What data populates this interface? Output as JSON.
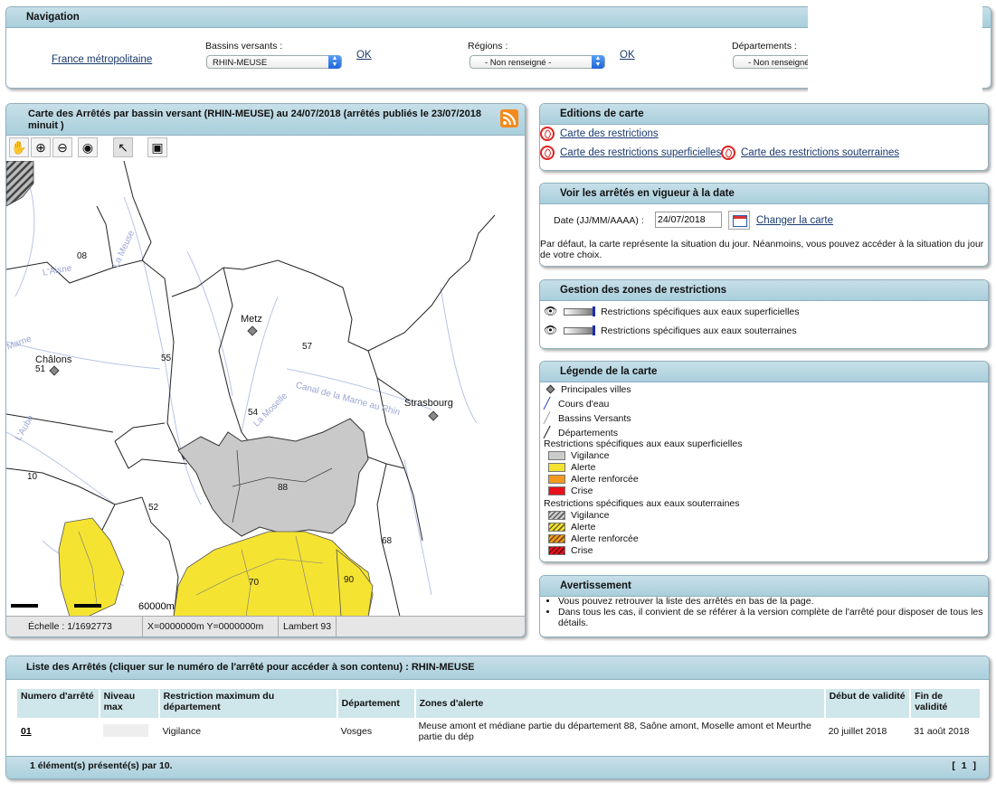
{
  "navigation": {
    "title": "Navigation",
    "france_link": "France métropolitaine",
    "bassins_label": "Bassins versants :",
    "bassins_value": "RHIN-MEUSE",
    "regions_label": "Régions :",
    "regions_value": "- Non renseigné -",
    "departements_label": "Départements :",
    "departements_value": "- Non renseigné -",
    "ok_label": "OK"
  },
  "map_panel": {
    "title": "Carte des Arrêtés par bassin versant (RHIN-MEUSE) au 24/07/2018 (arrêtés publiés le 23/07/2018 minuit )",
    "toolbar_icons": [
      "pan-hand-icon",
      "zoom-in-icon",
      "zoom-out-icon",
      "zoom-full-icon",
      "select-arrow-icon",
      "save-icon"
    ],
    "cities": [
      {
        "name": "Metz"
      },
      {
        "name": "Châlons"
      },
      {
        "name": "Strasbourg"
      }
    ],
    "dept_labels": [
      "08",
      "57",
      "51",
      "55",
      "54",
      "10",
      "52",
      "88",
      "68",
      "70",
      "90"
    ],
    "river_labels": [
      "L'Aisne",
      "La Meuse",
      "La Moselle",
      "Canal de la Marne au Rhin",
      "L'Aube",
      "Marne"
    ],
    "scale_text": "60000m",
    "status_scale": "Échelle : 1/1692773",
    "status_coords": "X=0000000m Y=0000000m",
    "status_projection": "Lambert 93"
  },
  "editions": {
    "title": "Editions de carte",
    "links": [
      "Carte des restrictions",
      "Carte des restrictions superficielles",
      "Carte des restrictions souterraines"
    ]
  },
  "date_panel": {
    "title": "Voir les arrêtés en vigueur à la date",
    "date_label": "Date (JJ/MM/AAAA) :",
    "date_value": "24/07/2018",
    "change_link": "Changer la carte",
    "description": "Par défaut, la carte représente la situation du jour. Néanmoins, vous pouvez accéder à la situation du jour de votre choix."
  },
  "zones_panel": {
    "title": "Gestion des zones de restrictions",
    "layers": [
      "Restrictions spécifiques aux eaux superficielles",
      "Restrictions spécifiques aux eaux souterraines"
    ]
  },
  "legend": {
    "title": "Légende de la carte",
    "items": [
      "Principales villes",
      "Cours d'eau",
      "Bassins Versants",
      "Départements"
    ],
    "surface_title": "Restrictions spécifiques aux eaux superficielles",
    "ground_title": "Restrictions spécifiques aux eaux souterraines",
    "levels": [
      {
        "label": "Vigilance",
        "color": "#cccccc"
      },
      {
        "label": "Alerte",
        "color": "#f5e332"
      },
      {
        "label": "Alerte renforcée",
        "color": "#f39a1e"
      },
      {
        "label": "Crise",
        "color": "#e8111b"
      }
    ]
  },
  "warning": {
    "title": "Avertissement",
    "items": [
      "Vous pouvez retrouver la liste des arrêtés en bas de la page.",
      "Dans tous les cas, il convient de se référer à la version complète de l'arrêté pour disposer de tous les détails."
    ]
  },
  "list": {
    "title": "Liste des Arrêtés (cliquer sur le numéro de l'arrêté pour accéder à son contenu) : RHIN-MEUSE",
    "headers": [
      "Numero d'arrêté",
      "Niveau max",
      "Restriction maximum du département",
      "Département",
      "Zones d'alerte",
      "Début de validité",
      "Fin de validité"
    ],
    "rows": [
      {
        "numero": "01",
        "restriction": "Vigilance",
        "departement": "Vosges",
        "zones": "Meuse amont et médiane partie du département 88, Saône amont, Moselle amont et Meurthe partie du dép",
        "debut": "20 juillet 2018",
        "fin": "31 août 2018"
      }
    ],
    "footer_count": "1 élément(s) présenté(s) par 10.",
    "pagination": "[ 1 ]"
  },
  "colors": {
    "header_bg": "#b7d6e0",
    "vigilance": "#cccccc",
    "alerte": "#f5e332",
    "link": "#1a3a6e"
  }
}
